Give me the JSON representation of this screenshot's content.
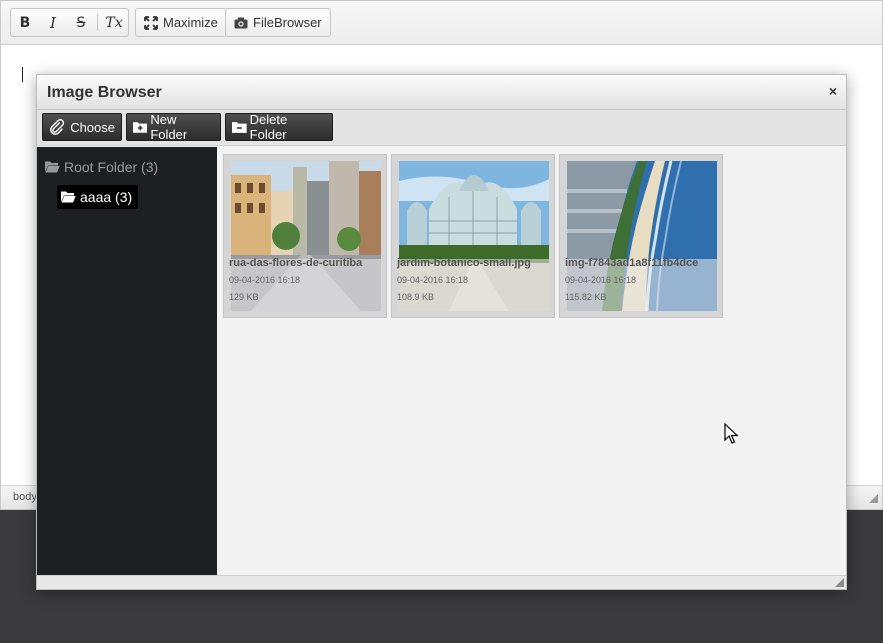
{
  "toolbar": {
    "bold_icon": "B",
    "italic_icon": "I",
    "strike_icon": "S",
    "clear_format_icon": "Tx",
    "maximize_label": "Maximize",
    "filebrowser_label": "FileBrowser"
  },
  "statusbar": {
    "path": "body"
  },
  "dialog": {
    "title": "Image Browser",
    "close_glyph": "×",
    "buttons": {
      "choose": "Choose",
      "new_folder": "New Folder",
      "delete_folder": "Delete Folder"
    },
    "folders": {
      "root": "Root Folder (3)",
      "sub": "aaaa (3)"
    },
    "files": [
      {
        "name": "rua-das-flores-de-curitiba",
        "date": "09-04-2016 16:18",
        "size": "129 KB"
      },
      {
        "name": "jardim-botanico-small.jpg",
        "date": "09-04-2016 16:18",
        "size": "108.9 KB"
      },
      {
        "name": "img-f7843ad1a8f11fb4dce",
        "date": "09-04-2016 16:18",
        "size": "115.82 KB"
      }
    ]
  },
  "colors": {
    "dialog_sidebar": "#1e1f20",
    "button_dark": "#333333",
    "backdrop": "#3a3a3c"
  }
}
